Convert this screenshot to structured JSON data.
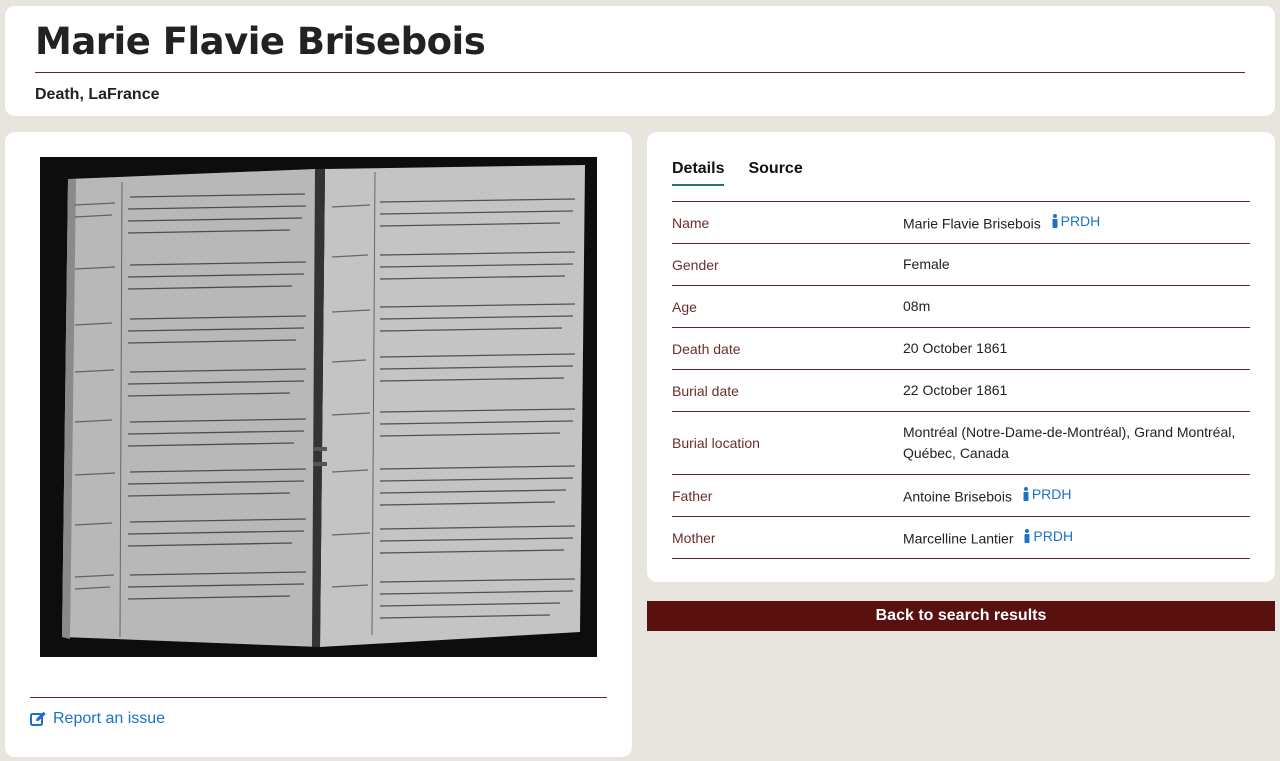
{
  "header": {
    "title": "Marie Flavie Brisebois",
    "subtitle": "Death, LaFrance"
  },
  "image_panel": {
    "report_label": "Report an issue"
  },
  "tabs": [
    {
      "label": "Details",
      "active": true
    },
    {
      "label": "Source",
      "active": false
    }
  ],
  "details": [
    {
      "label": "Name",
      "value": "Marie Flavie Brisebois",
      "link": "PRDH"
    },
    {
      "label": "Gender",
      "value": "Female"
    },
    {
      "label": "Age",
      "value": "08m"
    },
    {
      "label": "Death date",
      "value": "20 October 1861"
    },
    {
      "label": "Burial date",
      "value": "22 October 1861"
    },
    {
      "label": "Burial location",
      "value": "Montréal (Notre-Dame-de-Montréal), Grand Montréal, Québec, Canada"
    },
    {
      "label": "Father",
      "value": "Antoine Brisebois",
      "link": "PRDH"
    },
    {
      "label": "Mother",
      "value": "Marcelline Lantier",
      "link": "PRDH"
    }
  ],
  "back_button": {
    "label": "Back to search results"
  },
  "colors": {
    "background": "#e8e5df",
    "label": "#6b2e2e",
    "link": "#1a73c7",
    "button": "#5b1010",
    "rule": "#5a2a2a"
  }
}
